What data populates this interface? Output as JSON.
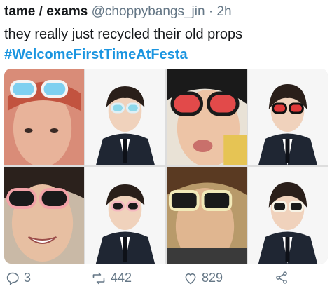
{
  "tweet": {
    "display_name": "tame / exams",
    "handle": "@choppybangs_jin",
    "time": "· 2h",
    "text": "they really just recycled their old props",
    "hashtag": "#WelcomeFirstTimeAtFesta"
  },
  "actions": {
    "reply_count": "3",
    "retweet_count": "442",
    "like_count": "829"
  },
  "colors": {
    "link": "#1b95e0",
    "muted": "#657786",
    "text": "#14171a"
  }
}
